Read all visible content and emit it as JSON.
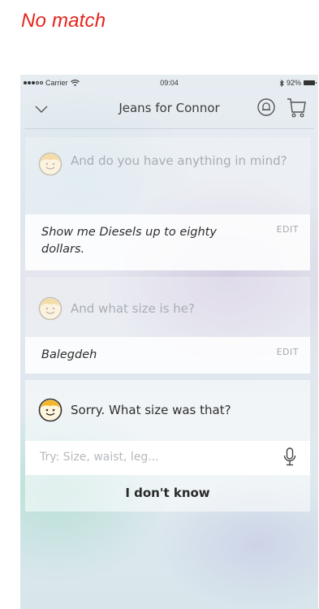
{
  "caption": "No match",
  "status": {
    "carrier": "Carrier",
    "time": "09:04",
    "battery": "92%"
  },
  "nav": {
    "title": "Jeans for Connor"
  },
  "conversation": [
    {
      "bot": "And do you have anything in mind?",
      "answer": "Show me Diesels up to eighty dollars.",
      "edit": "EDIT"
    },
    {
      "bot": "And what size is he?",
      "answer": "Balegdeh",
      "edit": "EDIT"
    }
  ],
  "current": {
    "bot": "Sorry. What size was that?",
    "input_placeholder": "Try: Size, waist, leg...",
    "idk": "I don't know"
  }
}
